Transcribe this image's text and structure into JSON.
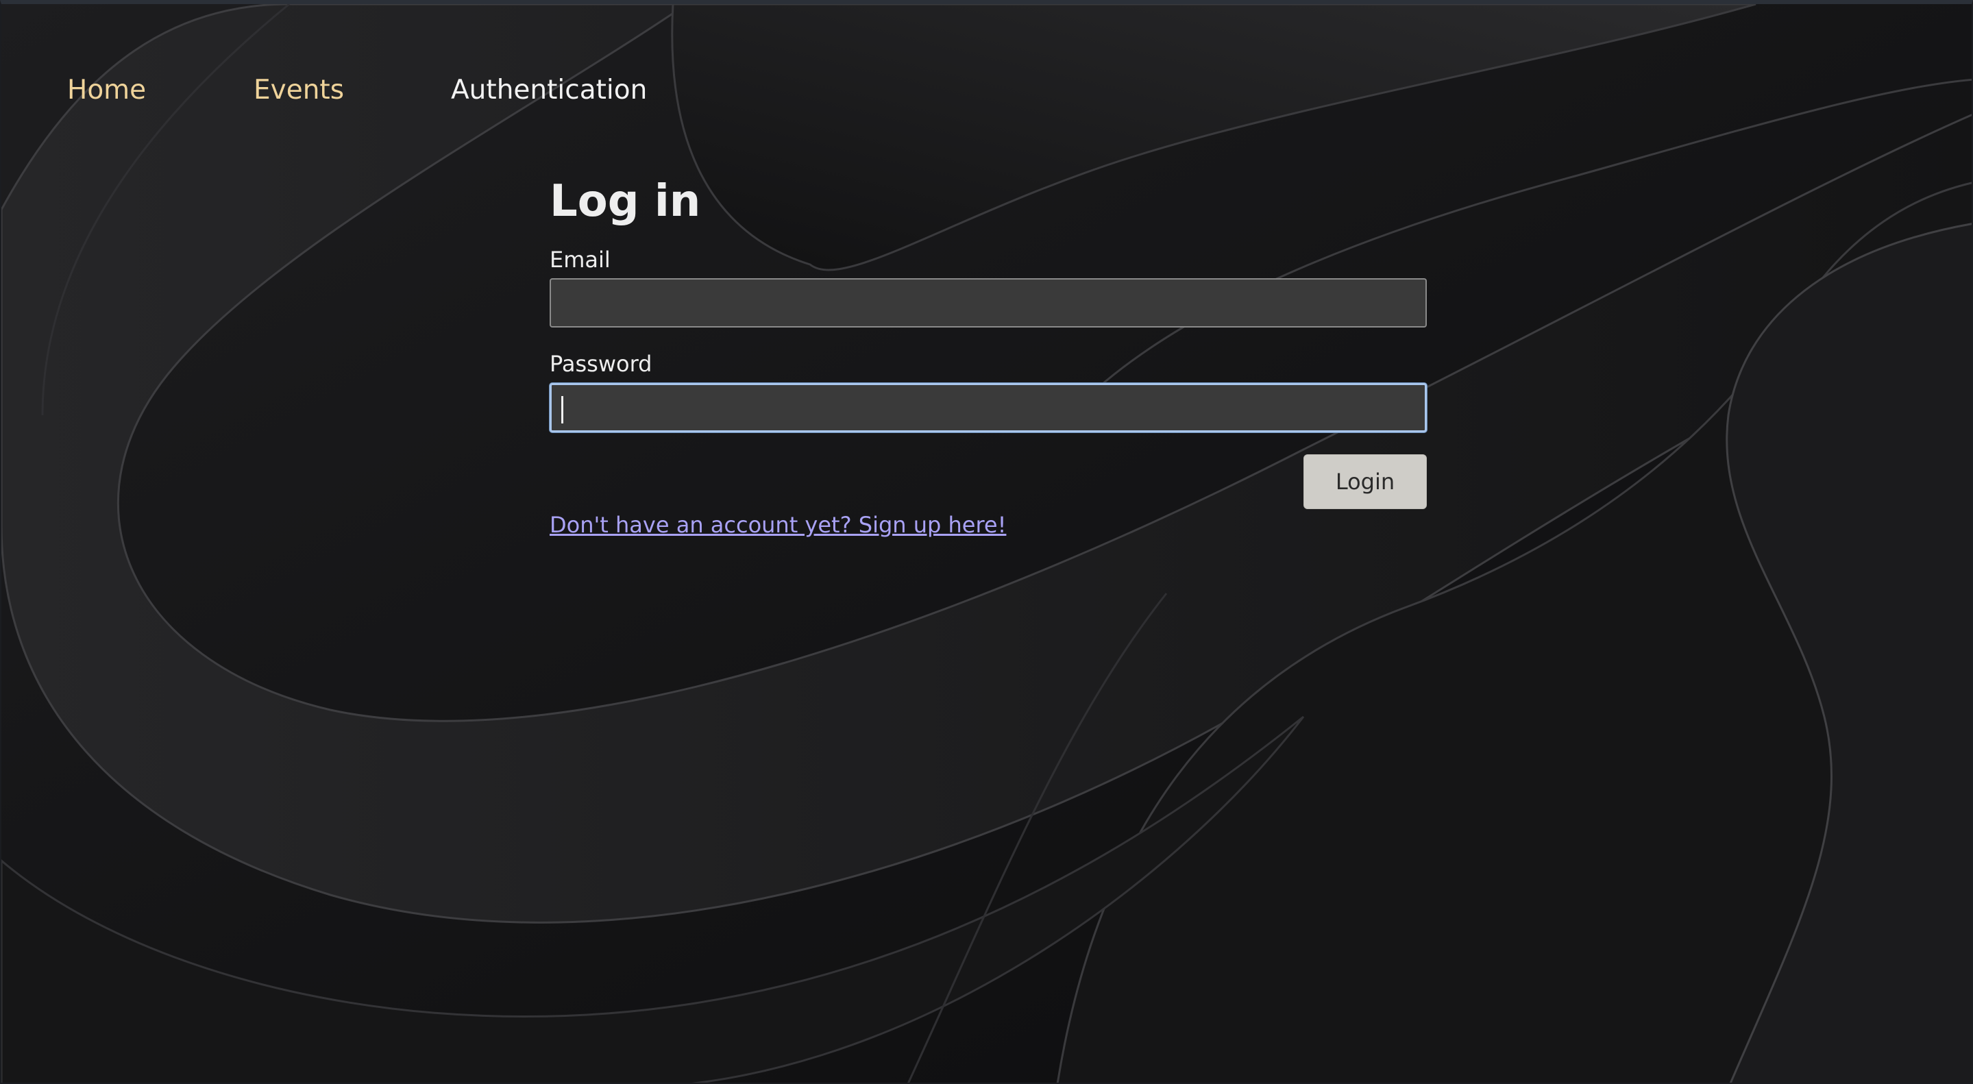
{
  "nav": {
    "home": "Home",
    "events": "Events",
    "authentication": "Authentication"
  },
  "login": {
    "title": "Log in",
    "email_label": "Email",
    "email_value": "",
    "password_label": "Password",
    "password_value": "",
    "submit_label": "Login",
    "signup_link": "Don't have an account yet? Sign up here!"
  },
  "colors": {
    "background": "#111112",
    "nav_link": "#efd39a",
    "nav_active": "#f3f3f3",
    "input_background": "#3a3a3a",
    "focus_border": "#a9c6ec",
    "button_background": "#cfcdc8",
    "link": "#a9a2f5"
  }
}
